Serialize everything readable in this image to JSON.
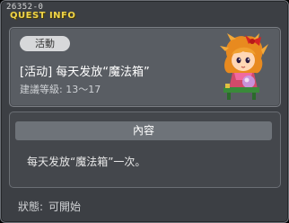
{
  "header": {
    "quest_id": "26352-0",
    "title": "QUEST INFO"
  },
  "quest": {
    "category": "活動",
    "title": "[活动] 每天发放“魔法箱”",
    "level_label": "建議等級",
    "level_range": "13～17",
    "npc_icon": "npc-girl-portrait"
  },
  "content": {
    "section_title": "內容",
    "description": "每天发放“魔法箱”一次。"
  },
  "status": {
    "label": "狀態:",
    "value": "可開始"
  },
  "colors": {
    "title_accent": "#f0d54a",
    "window_bg": "#3c3f44",
    "panel_bg": "#595d63"
  }
}
